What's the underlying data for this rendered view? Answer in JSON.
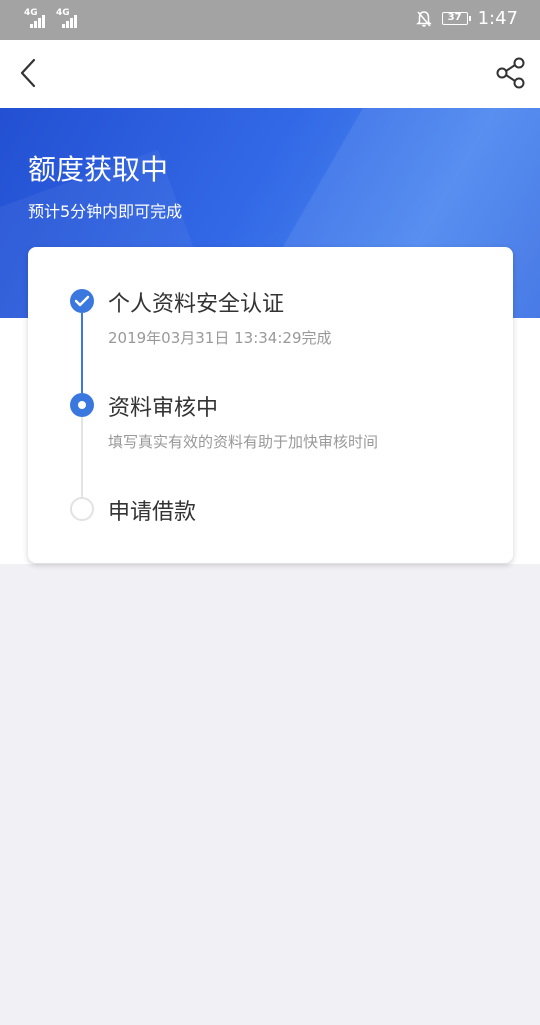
{
  "status_bar": {
    "network_1": "4G",
    "network_2": "4G",
    "battery": "37",
    "time": "1:47"
  },
  "nav": {
    "back_icon": "chevron-left-icon",
    "share_icon": "share-icon"
  },
  "hero": {
    "title": "额度获取中",
    "subtitle": "预计5分钟内即可完成"
  },
  "steps": [
    {
      "title": "个人资料安全认证",
      "desc": "2019年03月31日 13:34:29完成",
      "state": "done"
    },
    {
      "title": "资料审核中",
      "desc": "填写真实有效的资料有助于加快审核时间",
      "state": "current"
    },
    {
      "title": "申请借款",
      "desc": "",
      "state": "pending"
    }
  ],
  "colors": {
    "accent": "#3a78e0",
    "hero_gradient_start": "#2350d2",
    "hero_gradient_end": "#4a86ef",
    "page_bg": "#f1f0f4",
    "status_bar_bg": "#a3a3a3"
  }
}
